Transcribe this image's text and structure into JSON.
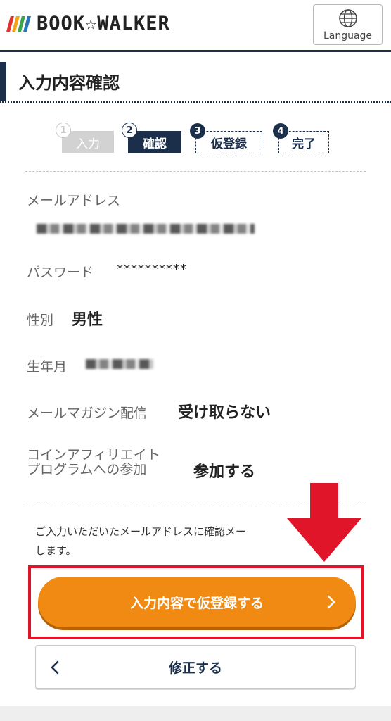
{
  "header": {
    "logo_text": "BOOK☆WALKER",
    "logo_colors": [
      "#e3322b",
      "#f3a31b",
      "#3aa54a",
      "#2b74b8"
    ],
    "language_label": "Language",
    "language_icon": "globe-icon"
  },
  "page": {
    "title": "入力内容確認"
  },
  "steps": [
    {
      "number": "1",
      "label": "入力",
      "state": "done"
    },
    {
      "number": "2",
      "label": "確認",
      "state": "current"
    },
    {
      "number": "3",
      "label": "仮登録",
      "state": "upcoming"
    },
    {
      "number": "4",
      "label": "完了",
      "state": "upcoming"
    }
  ],
  "fields": {
    "email": {
      "label": "メールアドレス",
      "value_state": "blurred"
    },
    "password": {
      "label": "パスワード",
      "value": "**********"
    },
    "gender": {
      "label": "性別",
      "value": "男性"
    },
    "birth": {
      "label": "生年月",
      "value_state": "blurred"
    },
    "newsletter": {
      "label": "メールマガジン配信",
      "value": "受け取らない"
    },
    "affiliate": {
      "label_line1": "コインアフィリエイト",
      "label_line2": "プログラムへの参加",
      "value": "参加する"
    }
  },
  "notice": {
    "line1": "ご入力いただいたメールアドレスに確認メー",
    "line2": "します。"
  },
  "buttons": {
    "submit_label": "入力内容で仮登録する",
    "back_label": "修正する"
  },
  "colors": {
    "navy": "#1c2f4a",
    "orange": "#f08a12",
    "highlight_red": "#e0152a"
  }
}
